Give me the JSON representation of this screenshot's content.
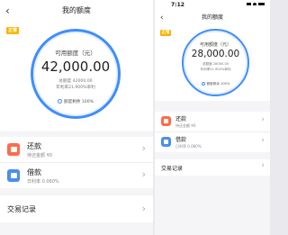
{
  "left": {
    "title": "我的额度",
    "back_icon": "‹",
    "tag": "正常",
    "available_label": "可用额度（元）",
    "available_amount": "42,000.00",
    "total_label": "总额度 42000.00",
    "rate_label": "年利率21.900%单利",
    "remaining_label": "额度剩余 100%",
    "repay_title": "还款",
    "repay_sub": "待还金额 ¥0",
    "borrow_title": "借款",
    "borrow_sub": "日利率 0.060%",
    "records_title": "交易记录"
  },
  "right": {
    "time": "7:12",
    "title": "我的额度",
    "back_icon": "‹",
    "tag": "正常",
    "available_label": "可用额度（元）",
    "available_amount": "28,000.00",
    "total_label": "总额度 28000.00",
    "rate_label": "年利率21.900%单利",
    "remaining_label": "额度剩余 100%",
    "repay_title": "还款",
    "repay_sub": "待还金额 ¥0",
    "borrow_title": "借款",
    "borrow_sub": "日利率 0.060%",
    "records_title": "交易记录"
  },
  "chevron": "›",
  "accent_color": "#3f8dff",
  "tag_color": "#f7b500"
}
